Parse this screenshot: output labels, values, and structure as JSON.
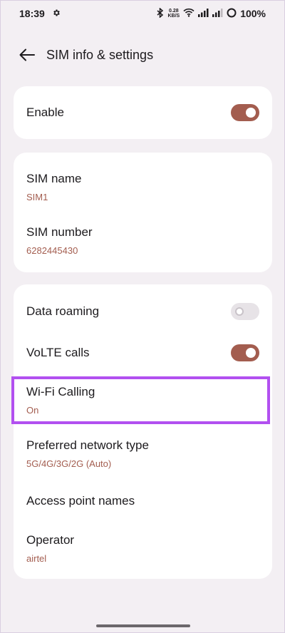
{
  "status_bar": {
    "time": "18:39",
    "net_speed_value": "0.28",
    "net_speed_unit": "KB/S",
    "battery": "100%"
  },
  "header": {
    "title": "SIM info & settings"
  },
  "card_enable": {
    "enable_label": "Enable",
    "enable_on": true
  },
  "card_sim": {
    "sim_name_label": "SIM name",
    "sim_name_value": "SIM1",
    "sim_number_label": "SIM number",
    "sim_number_value": "6282445430"
  },
  "card_network": {
    "data_roaming_label": "Data roaming",
    "data_roaming_on": false,
    "volte_label": "VoLTE calls",
    "volte_on": true,
    "wifi_calling_label": "Wi-Fi Calling",
    "wifi_calling_value": "On",
    "preferred_network_label": "Preferred network type",
    "preferred_network_value": "5G/4G/3G/2G (Auto)",
    "apn_label": "Access point names",
    "operator_label": "Operator",
    "operator_value": "airtel"
  },
  "colors": {
    "accent": "#a35d4f",
    "highlight": "#b250f0",
    "background": "#f3eff3"
  }
}
